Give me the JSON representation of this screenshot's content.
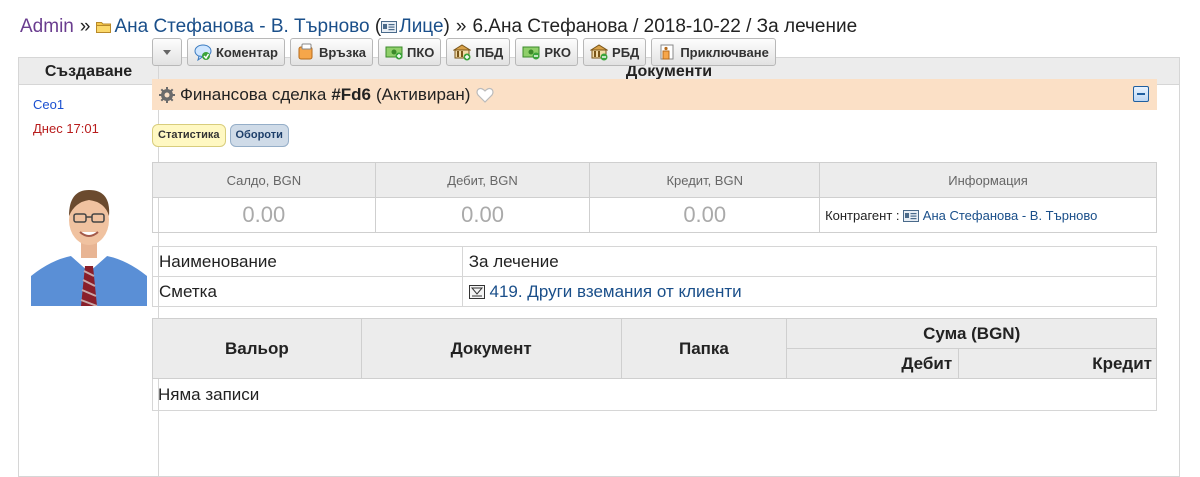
{
  "breadcrumb": {
    "root": "Admin",
    "sep1": "»",
    "client": "Ана Стефанова - В. Търново",
    "open_paren": " (",
    "client_type": "Лице",
    "close_paren": ")",
    "sep2": "»",
    "current": "6.Ана Стефанова / 2018-10-22 / За лечение"
  },
  "header": {
    "left": "Създаване",
    "right": "Документи"
  },
  "creator": {
    "name": "Ceo1",
    "date": "Днес 17:01"
  },
  "toolbar": {
    "comment": "Коментар",
    "link": "Връзка",
    "pko": "ПКО",
    "pbd": "ПБД",
    "rko": "РКО",
    "rbd": "РБД",
    "adventure": "Приключване"
  },
  "deal": {
    "title": "Финансова сделка",
    "code": "#Fd6",
    "state": "(Активиран)"
  },
  "tags": {
    "stats": "Статистика",
    "turnover": "Обороти"
  },
  "balance": {
    "headers": [
      "Салдо, BGN",
      "Дебит, BGN",
      "Кредит, BGN",
      "Информация"
    ],
    "values": [
      "0.00",
      "0.00",
      "0.00"
    ],
    "info_label": "Контрагент :",
    "info_link": "Ана Стефанова - В. Търново"
  },
  "details": {
    "name_label": "Наименование",
    "name_value": "За лечение",
    "account_label": "Сметка",
    "account_value": "419. Други вземания от клиенти"
  },
  "movements": {
    "col_valor": "Вальор",
    "col_document": "Документ",
    "col_folder": "Папка",
    "col_amount": "Сума (BGN)",
    "col_debit": "Дебит",
    "col_credit": "Кредит",
    "empty": "Няма записи"
  },
  "colors": {
    "deal_bg": "#fbe0c6",
    "link": "#1a4f8a",
    "date_red": "#b81c1c"
  }
}
